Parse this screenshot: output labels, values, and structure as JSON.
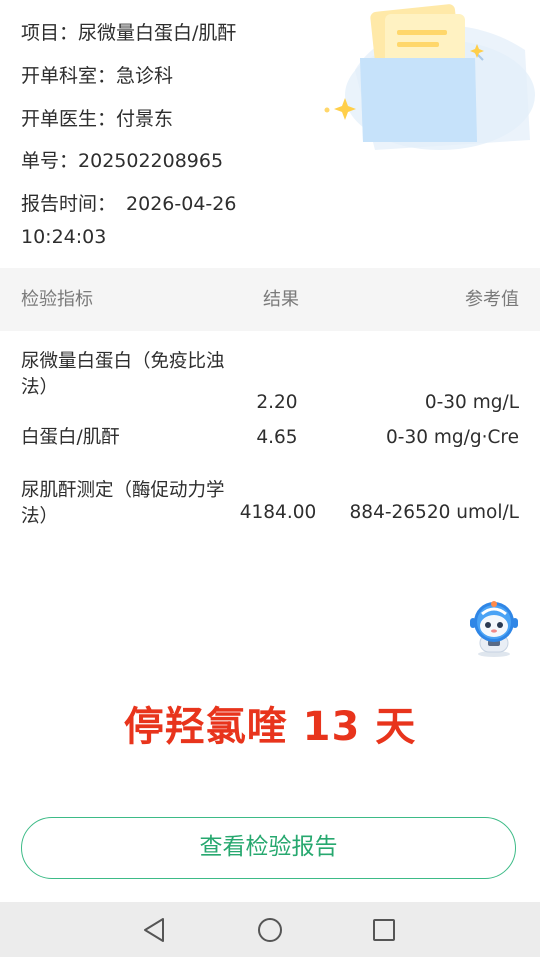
{
  "info": {
    "project_label": "项目：",
    "project_value": "尿微量白蛋白/肌酐",
    "dept_label": "开单科室：",
    "dept_value": "急诊科",
    "doctor_label": "开单医生：",
    "doctor_value": "付景东",
    "order_label": "单号：",
    "order_value": "202502208965",
    "time_label": "报告时间：",
    "time_value": "2026-04-26 10:24:03"
  },
  "table": {
    "headers": {
      "name": "检验指标",
      "result": "结果",
      "reference": "参考值"
    },
    "rows": [
      {
        "name": "尿微量白蛋白（免疫比浊法）",
        "result": "2.20",
        "reference": "0-30 mg/L"
      },
      {
        "name": "白蛋白/肌酐",
        "result": "4.65",
        "reference": "0-30 mg/g·Cre"
      },
      {
        "name": "尿肌酐测定（酶促动力学法）",
        "result": "4184.00",
        "reference": "884-26520 umol/L"
      }
    ]
  },
  "caption": "停羟氯喹 13 天",
  "button": {
    "view_report": "查看检验报告"
  },
  "icons": {
    "illustration": "document-folder-illustration",
    "assistant": "robot-assistant-icon",
    "nav_back": "back-triangle-icon",
    "nav_home": "home-circle-icon",
    "nav_recent": "recent-square-icon"
  },
  "colors": {
    "accent_green": "#27a86f",
    "caption_red": "#e8341c",
    "header_bg": "#f5f5f5"
  }
}
